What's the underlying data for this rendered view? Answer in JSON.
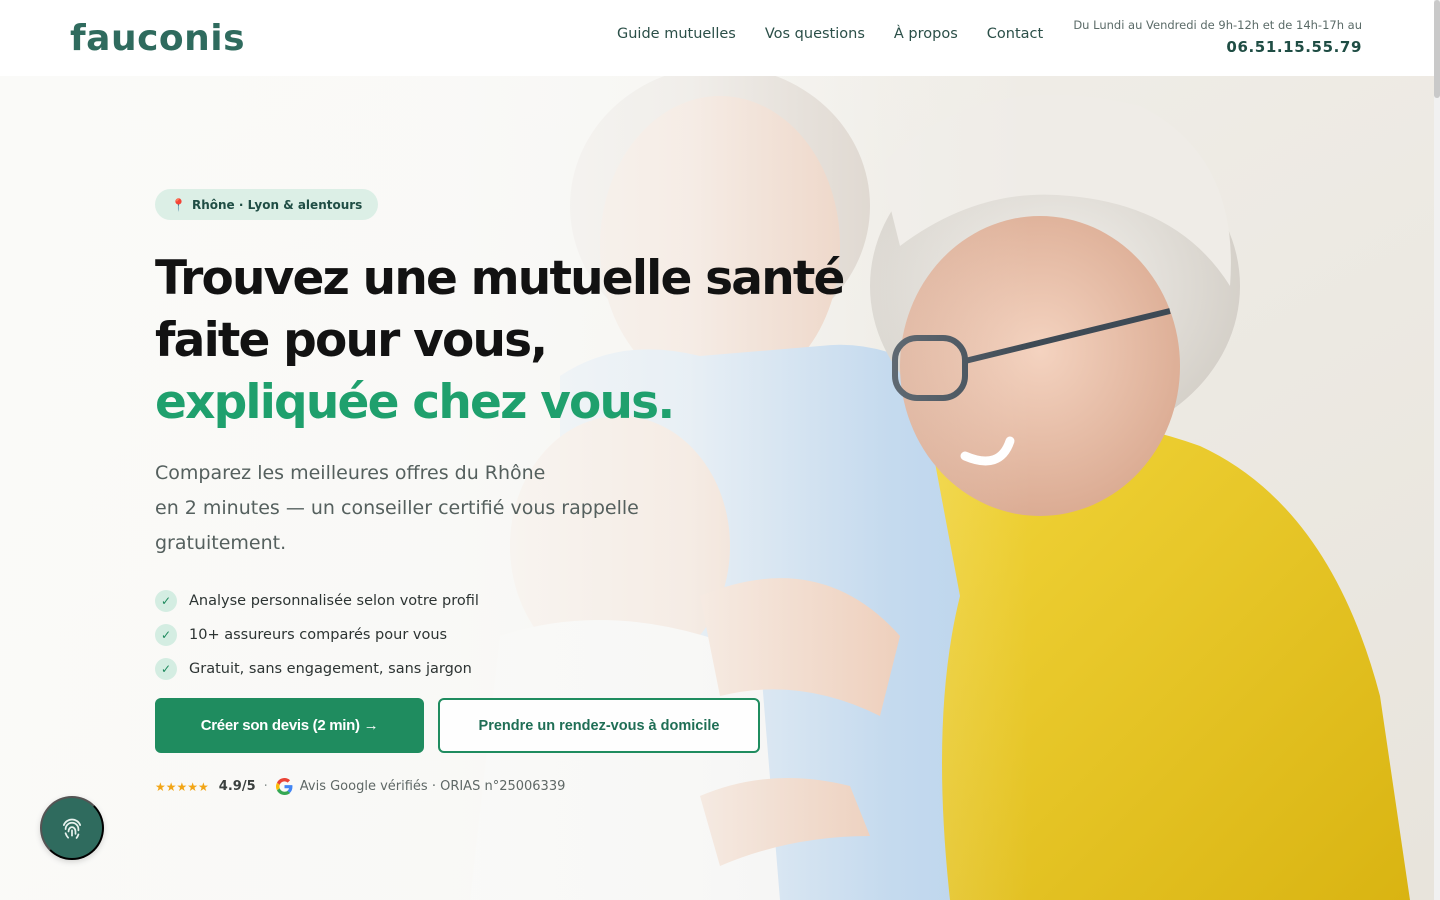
{
  "brand": {
    "name": "fauconis",
    "color": "#2f6b5e",
    "accent": "#1fa06d"
  },
  "nav": {
    "items": [
      {
        "label": "Guide mutuelles"
      },
      {
        "label": "Vos questions"
      },
      {
        "label": "À propos"
      },
      {
        "label": "Contact"
      }
    ]
  },
  "contact": {
    "hours": "Du Lundi au Vendredi de 9h-12h et de 14h-17h au",
    "phone": "06.51.15.55.79"
  },
  "hero": {
    "badge": "Rhône · Lyon & alentours",
    "title_line1": "Trouvez une mutuelle santé",
    "title_line2": "faite pour vous,",
    "title_line3": "expliquée chez vous.",
    "lead_line1": "Comparez les meilleures offres du Rhône",
    "lead_line2": "en 2 minutes — un conseiller certifié vous rappelle",
    "lead_line3": "gratuitement.",
    "checks": [
      {
        "label": "Analyse personnalisée selon votre profil"
      },
      {
        "label": "10+ assureurs comparés pour vous"
      },
      {
        "label": "Gratuit, sans engagement, sans jargon"
      }
    ],
    "cta_primary": "Créer son devis (2 min) →",
    "cta_secondary": "Prendre un rendez-vous à domicile",
    "rating": {
      "stars": 5,
      "stars_text": "★★★★★",
      "score": "4.9/5",
      "dot": "·",
      "source": "Avis Google vérifiés · ORIAS n°25006339"
    }
  },
  "icons": {
    "badge": "location-pin-icon",
    "check": "check-icon",
    "google": "google-icon",
    "fab": "fingerprint-icon"
  }
}
